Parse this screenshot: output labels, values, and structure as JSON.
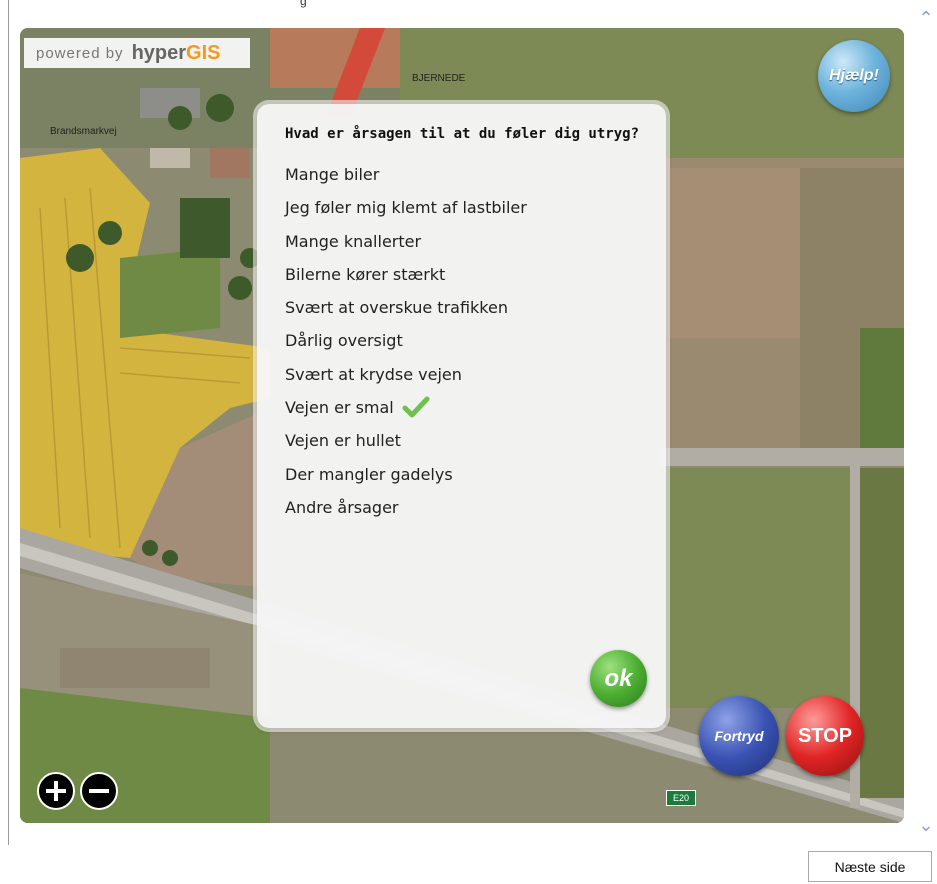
{
  "header": {
    "top_text": "g"
  },
  "map": {
    "powered_by": "powered by",
    "logo_hyper": "hyper",
    "logo_gis": "GIS",
    "labels": {
      "bjernede": "BJERNEDE",
      "brandsmarkvej": "Brandsmarkvej",
      "road_sign": "E20"
    }
  },
  "help_button": {
    "label": "Hjælp!"
  },
  "dialog": {
    "question": "Hvad er årsagen til at du føler dig utryg?",
    "options": [
      {
        "label": "Mange biler",
        "checked": false
      },
      {
        "label": "Jeg føler mig klemt af lastbiler",
        "checked": false
      },
      {
        "label": "Mange knallerter",
        "checked": false
      },
      {
        "label": "Bilerne kører stærkt",
        "checked": false
      },
      {
        "label": "Svært at overskue trafikken",
        "checked": false
      },
      {
        "label": "Dårlig oversigt",
        "checked": false
      },
      {
        "label": "Svært at krydse vejen",
        "checked": false
      },
      {
        "label": "Vejen er smal",
        "checked": true
      },
      {
        "label": "Vejen er hullet",
        "checked": false
      },
      {
        "label": "Der mangler gadelys",
        "checked": false
      },
      {
        "label": "Andre årsager",
        "checked": false
      }
    ],
    "ok_label": "ok"
  },
  "actions": {
    "undo_label": "Fortryd",
    "stop_label": "STOP"
  },
  "navigation": {
    "next_label": "Næste side"
  },
  "colors": {
    "check": "#6cc24a",
    "ok": "#4caf32",
    "undo": "#3a53b3",
    "stop": "#e02424",
    "help": "#6eb4dd",
    "gis_orange": "#f29a1e"
  },
  "icons": {
    "zoom_in": "plus-circle-icon",
    "zoom_out": "minus-circle-icon",
    "check": "checkmark-icon",
    "scroll_up": "chevron-up-icon",
    "scroll_down": "chevron-down-icon"
  }
}
